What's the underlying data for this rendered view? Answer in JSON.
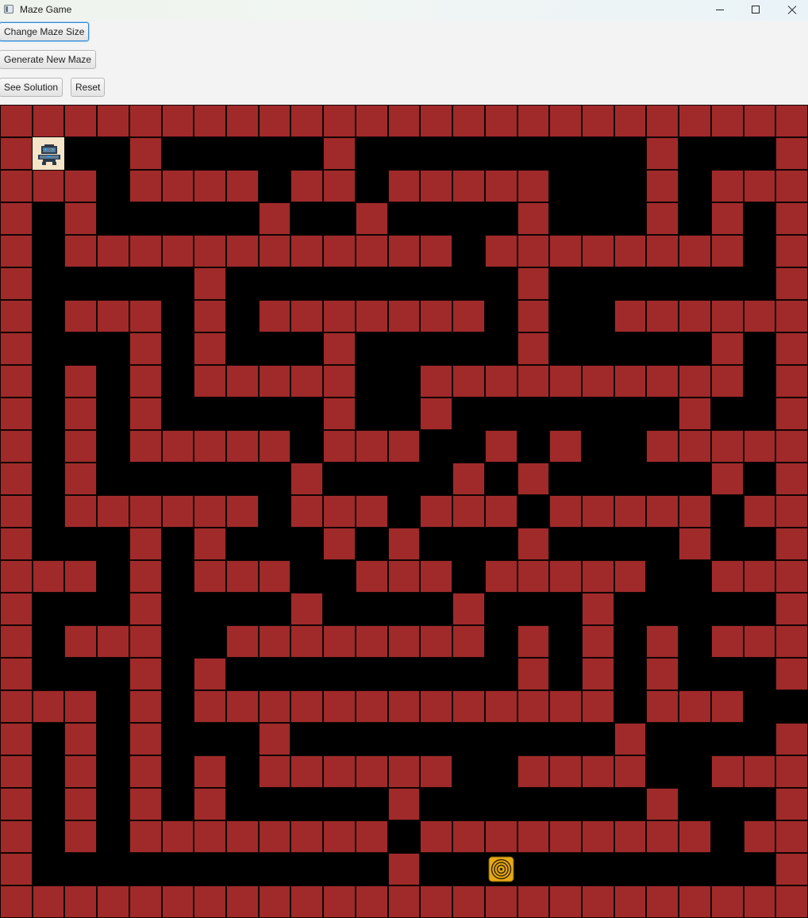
{
  "window": {
    "title": "Maze Game",
    "min_icon": "minimize-icon",
    "max_icon": "maximize-icon",
    "close_icon": "close-icon"
  },
  "toolbar": {
    "change_size_label": "Change Maze Size",
    "generate_label": "Generate New Maze",
    "solution_label": "See Solution",
    "reset_label": "Reset"
  },
  "maze": {
    "rows": 25,
    "cols": 25,
    "wall_color": "#a02a2a",
    "path_color": "#000000",
    "player": {
      "row": 1,
      "col": 1,
      "icon": "robot-icon"
    },
    "goal": {
      "row": 23,
      "col": 14,
      "icon": "target-icon"
    },
    "grid": [
      "#########################",
      "#P  #     #         #   #",
      "### #### ## #####   # ###",
      "# #     #  #    #   # # #",
      "# ############ ######## #",
      "#     #         #       #",
      "# ### # ####### #  ######",
      "#   # #   #     #     # #",
      "# # # #####  ########## #",
      "# # #     #  #       #  #",
      "# # ##### ###  # #  #####",
      "# #      #    # #     # #",
      "# ###### ### ### ##### ##",
      "#   # #   # #   #    #  #",
      "### # ###  ### #####  ###",
      "#   #    #    #   #     #",
      "# ###  ######## # # # ###",
      "#   # #         # # #   #",
      "### # ############# ###  #",
      "# # #   #          #    #",
      "# # # # ######  ####  ###",
      "# # # #     #       #   #",
      "# # ######## ######### ##",
      "#           #  G        #",
      "#########################"
    ]
  }
}
